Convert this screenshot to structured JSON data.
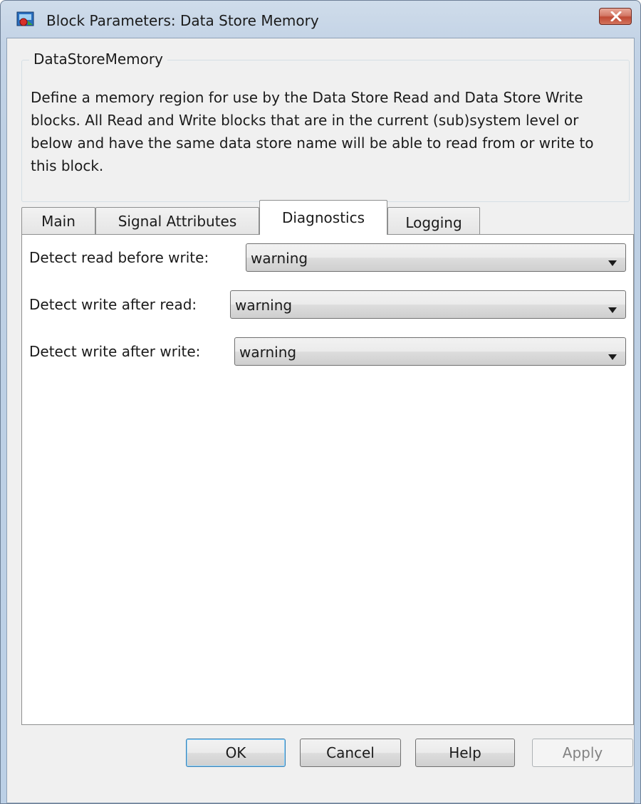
{
  "window": {
    "title": "Block Parameters: Data Store Memory",
    "icon": "simulink-block-icon",
    "close_icon": "close-icon"
  },
  "description_group": {
    "title": "DataStoreMemory",
    "text": "Define a memory region for use by the Data Store Read and Data Store Write blocks. All Read and Write blocks that are in the current (sub)system level or below and have the same data store name will be able to read from or write to this block."
  },
  "tabs": [
    {
      "label": "Main",
      "active": false
    },
    {
      "label": "Signal Attributes",
      "active": false
    },
    {
      "label": "Diagnostics",
      "active": true
    },
    {
      "label": "Logging",
      "active": false
    }
  ],
  "diagnostics": [
    {
      "label": "Detect read before write:",
      "value": "warning"
    },
    {
      "label": "Detect write after read:",
      "value": "warning"
    },
    {
      "label": "Detect write after write:",
      "value": "warning"
    }
  ],
  "buttons": {
    "ok": "OK",
    "cancel": "Cancel",
    "help": "Help",
    "apply": "Apply",
    "apply_enabled": false
  },
  "colors": {
    "window_frame": "#bcd0e6",
    "client_background": "#f0f0f0",
    "close_button": "#c04a35",
    "default_button_border": "#3c7fb1"
  }
}
